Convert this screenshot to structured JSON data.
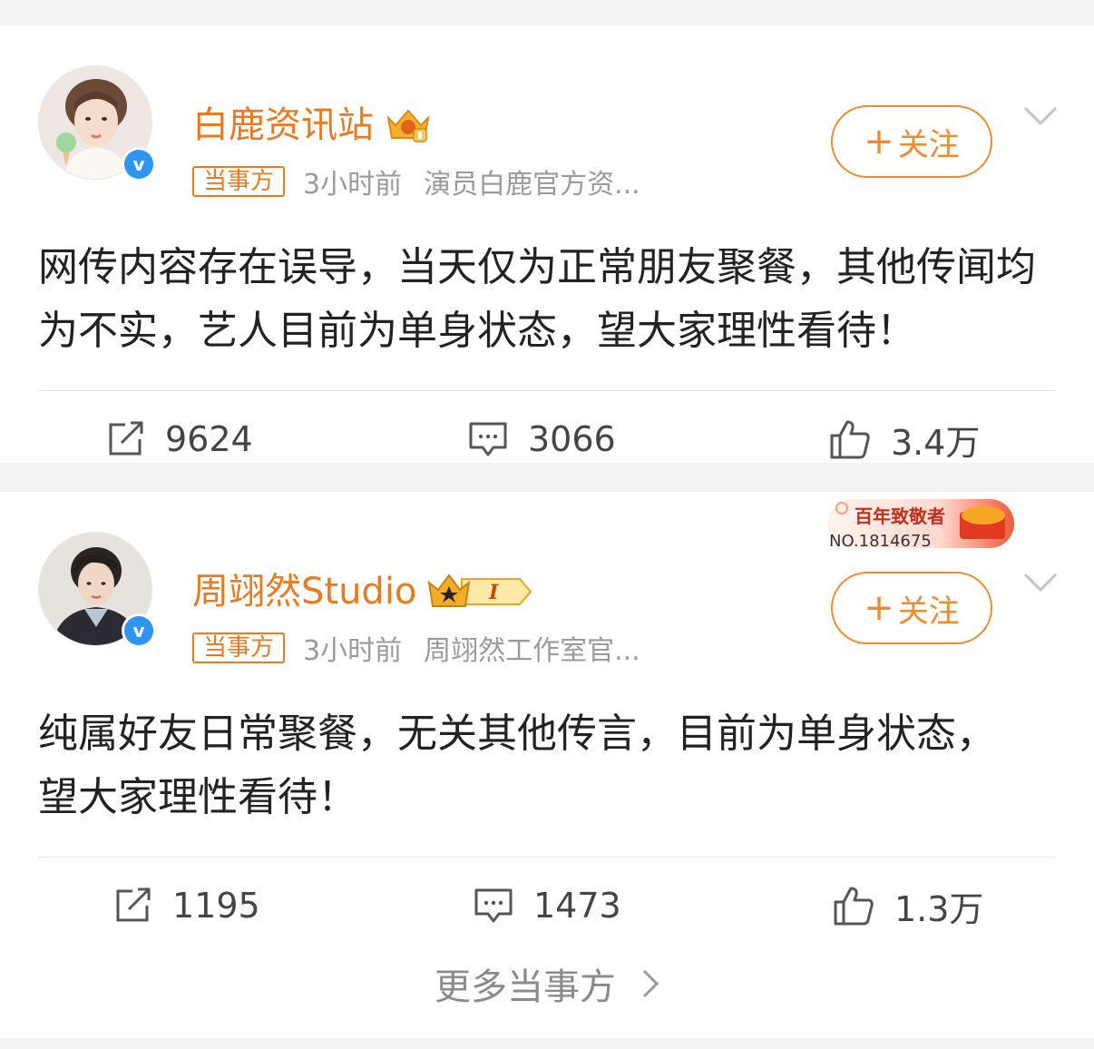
{
  "posts": [
    {
      "author": "白鹿资讯站",
      "tag": "当事方",
      "time": "3小时前",
      "desc": "演员白鹿官方资...",
      "follow_label": "关注",
      "follow_plus": "+",
      "verified": "v",
      "content": "网传内容存在误导，当天仅为正常朋友聚餐，其他传闻均为不实，艺人目前为单身状态，望大家理性看待！",
      "reposts": "9624",
      "comments": "3066",
      "likes": "3.4万"
    },
    {
      "author": "周翊然Studio",
      "tag": "当事方",
      "time": "3小时前",
      "desc": "周翊然工作室官...",
      "follow_label": "关注",
      "follow_plus": "+",
      "verified": "v",
      "badge_text": "I",
      "banner_title": "百年致敬者",
      "banner_no": "NO.1814675",
      "content": "纯属好友日常聚餐，无关其他传言，目前为单身状态，望大家理性看待！",
      "reposts": "1195",
      "comments": "1473",
      "likes": "1.3万"
    }
  ],
  "more": {
    "label": "更多当事方"
  },
  "colors": {
    "accent": "#eb7a1f",
    "verified": "#2f95f4",
    "text": "#222222",
    "muted": "#9a9a9a"
  }
}
